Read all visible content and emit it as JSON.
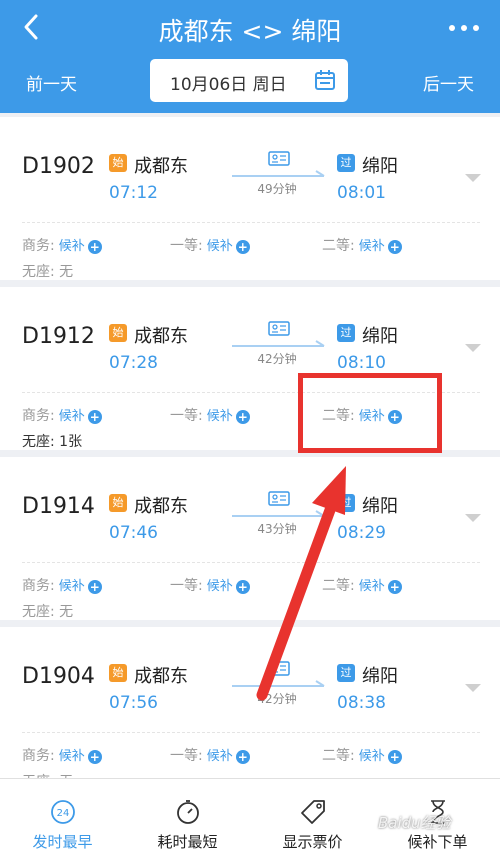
{
  "header": {
    "title": "成都东 <> 绵阳",
    "prev_day": "前一天",
    "next_day": "后一天",
    "date": "10月06日 周日"
  },
  "trains": [
    {
      "number": "D1902",
      "dep_badge": "始",
      "arr_badge": "过",
      "dep_station": "成都东",
      "arr_station": "绵阳",
      "dep_time": "07:12",
      "arr_time": "08:01",
      "duration": "49分钟",
      "seats": [
        {
          "label": "商务:",
          "status": "候补"
        },
        {
          "label": "一等:",
          "status": "候补"
        },
        {
          "label": "二等:",
          "status": "候补"
        }
      ],
      "no_seat": "无座: 无",
      "no_seat_available": false
    },
    {
      "number": "D1912",
      "dep_badge": "始",
      "arr_badge": "过",
      "dep_station": "成都东",
      "arr_station": "绵阳",
      "dep_time": "07:28",
      "arr_time": "08:10",
      "duration": "42分钟",
      "seats": [
        {
          "label": "商务:",
          "status": "候补"
        },
        {
          "label": "一等:",
          "status": "候补"
        },
        {
          "label": "二等:",
          "status": "候补"
        }
      ],
      "no_seat": "无座: 1张",
      "no_seat_available": true
    },
    {
      "number": "D1914",
      "dep_badge": "始",
      "arr_badge": "过",
      "dep_station": "成都东",
      "arr_station": "绵阳",
      "dep_time": "07:46",
      "arr_time": "08:29",
      "duration": "43分钟",
      "seats": [
        {
          "label": "商务:",
          "status": "候补"
        },
        {
          "label": "一等:",
          "status": "候补"
        },
        {
          "label": "二等:",
          "status": "候补"
        }
      ],
      "no_seat": "无座: 无",
      "no_seat_available": false
    },
    {
      "number": "D1904",
      "dep_badge": "始",
      "arr_badge": "过",
      "dep_station": "成都东",
      "arr_station": "绵阳",
      "dep_time": "07:56",
      "arr_time": "08:38",
      "duration": "42分钟",
      "seats": [
        {
          "label": "商务:",
          "status": "候补"
        },
        {
          "label": "一等:",
          "status": "候补"
        },
        {
          "label": "二等:",
          "status": "候补"
        }
      ],
      "no_seat": "无座: 无",
      "no_seat_available": false
    }
  ],
  "bottom_tabs": [
    {
      "label": "发时最早",
      "icon": "clock-24-icon",
      "active": true,
      "icon_text": "24"
    },
    {
      "label": "耗时最短",
      "icon": "stopwatch-icon",
      "active": false
    },
    {
      "label": "显示票价",
      "icon": "price-tag-icon",
      "active": false
    },
    {
      "label": "候补下单",
      "icon": "hourglass-icon",
      "active": false
    }
  ],
  "watermark": "Baidu经验",
  "colors": {
    "primary": "#3d9ae8",
    "start_badge": "#f59a2a",
    "annotation": "#e8332e",
    "background": "#eef0f4"
  }
}
